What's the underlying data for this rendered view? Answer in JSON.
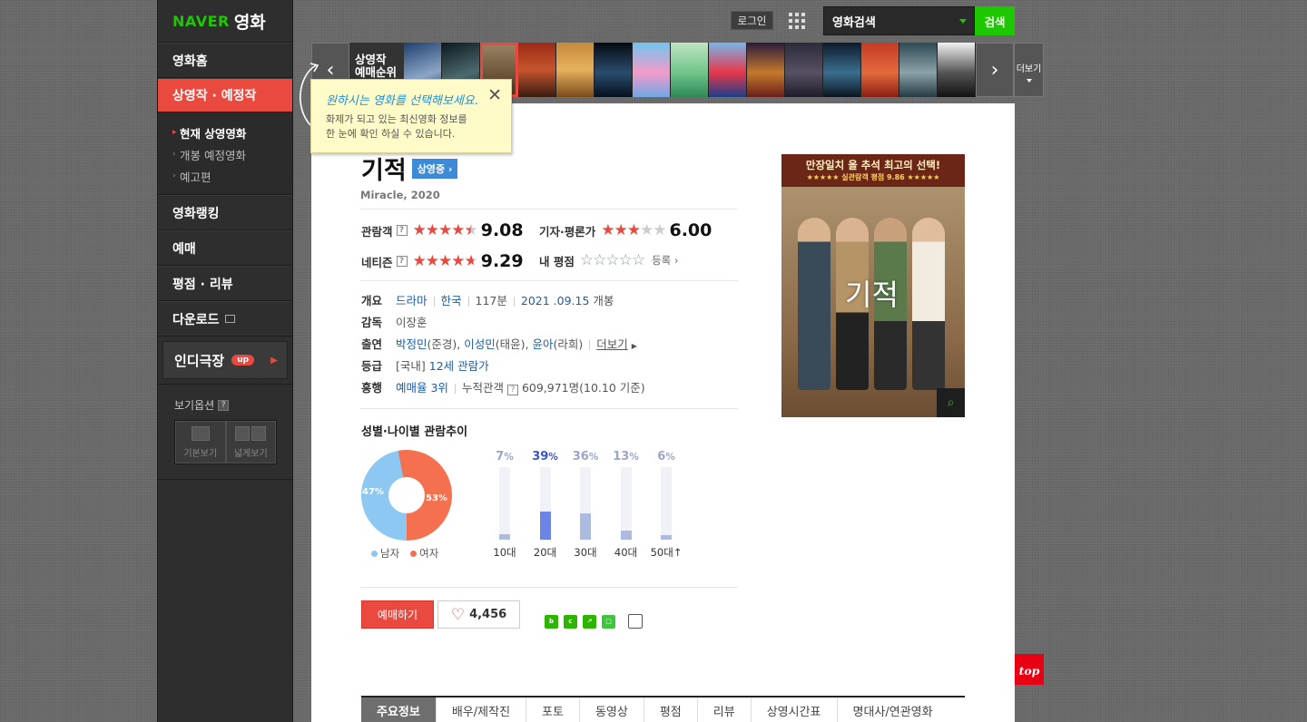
{
  "sidebar": {
    "logo_brand": "NAVER",
    "logo_service": "영화",
    "nav": [
      {
        "label": "영화홈"
      },
      {
        "label": "상영작 · 예정작"
      }
    ],
    "subnav": [
      {
        "label": "현재 상영영화"
      },
      {
        "label": "개봉 예정영화"
      },
      {
        "label": "예고편"
      }
    ],
    "nav2": [
      {
        "label": "영화랭킹"
      },
      {
        "label": "예매"
      },
      {
        "label": "평점 · 리뷰"
      },
      {
        "label": "다운로드"
      }
    ],
    "indie_label": "인디극장",
    "indie_badge": "up",
    "view_option_label": "보기옵션",
    "view_basic": "기본보기",
    "view_wide": "넓게보기"
  },
  "header": {
    "login": "로그인",
    "search_category": "영화검색",
    "search_button": "검색"
  },
  "carousel": {
    "label_line1": "상영작",
    "label_line2": "예매순위",
    "more": "더보기"
  },
  "tooltip": {
    "head": "원하시는 영화를 선택해보세요.",
    "body_line1": "화제가 되고 있는 최신영화 정보를",
    "body_line2": "한 눈에 확인 하실 수 있습니다."
  },
  "movie": {
    "title": "기적",
    "status": "상영중",
    "subtitle": "Miracle, 2020",
    "audience_label": "관람객",
    "audience_score": "9.08",
    "critic_label": "기자·평론가",
    "critic_score": "6.00",
    "netizen_label": "네티즌",
    "netizen_score": "9.29",
    "my_rating_label": "내 평점",
    "register": "등록"
  },
  "info": {
    "overview_label": "개요",
    "genre": "드라마",
    "country": "한국",
    "runtime": "117분",
    "release_date": "2021 .09.15",
    "release_suffix": "개봉",
    "director_label": "감독",
    "director": "이장훈",
    "cast_label": "출연",
    "cast1": "박정민",
    "cast1_role": "(준경), ",
    "cast2": "이성민",
    "cast2_role": "(태윤), ",
    "cast3": "윤아",
    "cast3_role": "(라희)",
    "cast_more": "더보기",
    "rating_label": "등급",
    "rating_prefix": "[국내]",
    "rating": "12세 관람가",
    "box_label": "흥행",
    "booking_rank": "예매율 3위",
    "cumulative_label": "누적관객",
    "cumulative_value": "609,971명(10.10 기준)"
  },
  "demographics": {
    "title": "성별·나이별 관람추이",
    "male_pct": 47,
    "female_pct": 53,
    "male_label": "남자",
    "female_label": "여자",
    "male_color": "#8cc8f2",
    "female_color": "#f4704e",
    "ages": [
      {
        "label": "10대",
        "pct": 7
      },
      {
        "label": "20대",
        "pct": 39
      },
      {
        "label": "30대",
        "pct": 36
      },
      {
        "label": "40대",
        "pct": 13
      },
      {
        "label": "50대↑",
        "pct": 6
      }
    ],
    "pct_suffix": "%"
  },
  "actions": {
    "book": "예매하기",
    "likes": "4,456"
  },
  "tabs": [
    "주요정보",
    "배우/제작진",
    "포토",
    "동영상",
    "평점",
    "리뷰",
    "상영시간표",
    "명대사/연관영화"
  ],
  "poster": {
    "tagline": "만장일치 올 추석 최고의 선택!",
    "rating_line": "★★★★★ 실관람객 평점 9.86 ★★★★★",
    "title": "기적"
  },
  "top_button": "top",
  "colors": {
    "accent": "#e9493f",
    "naver_green": "#1ec800",
    "link": "#1b5ea8"
  }
}
